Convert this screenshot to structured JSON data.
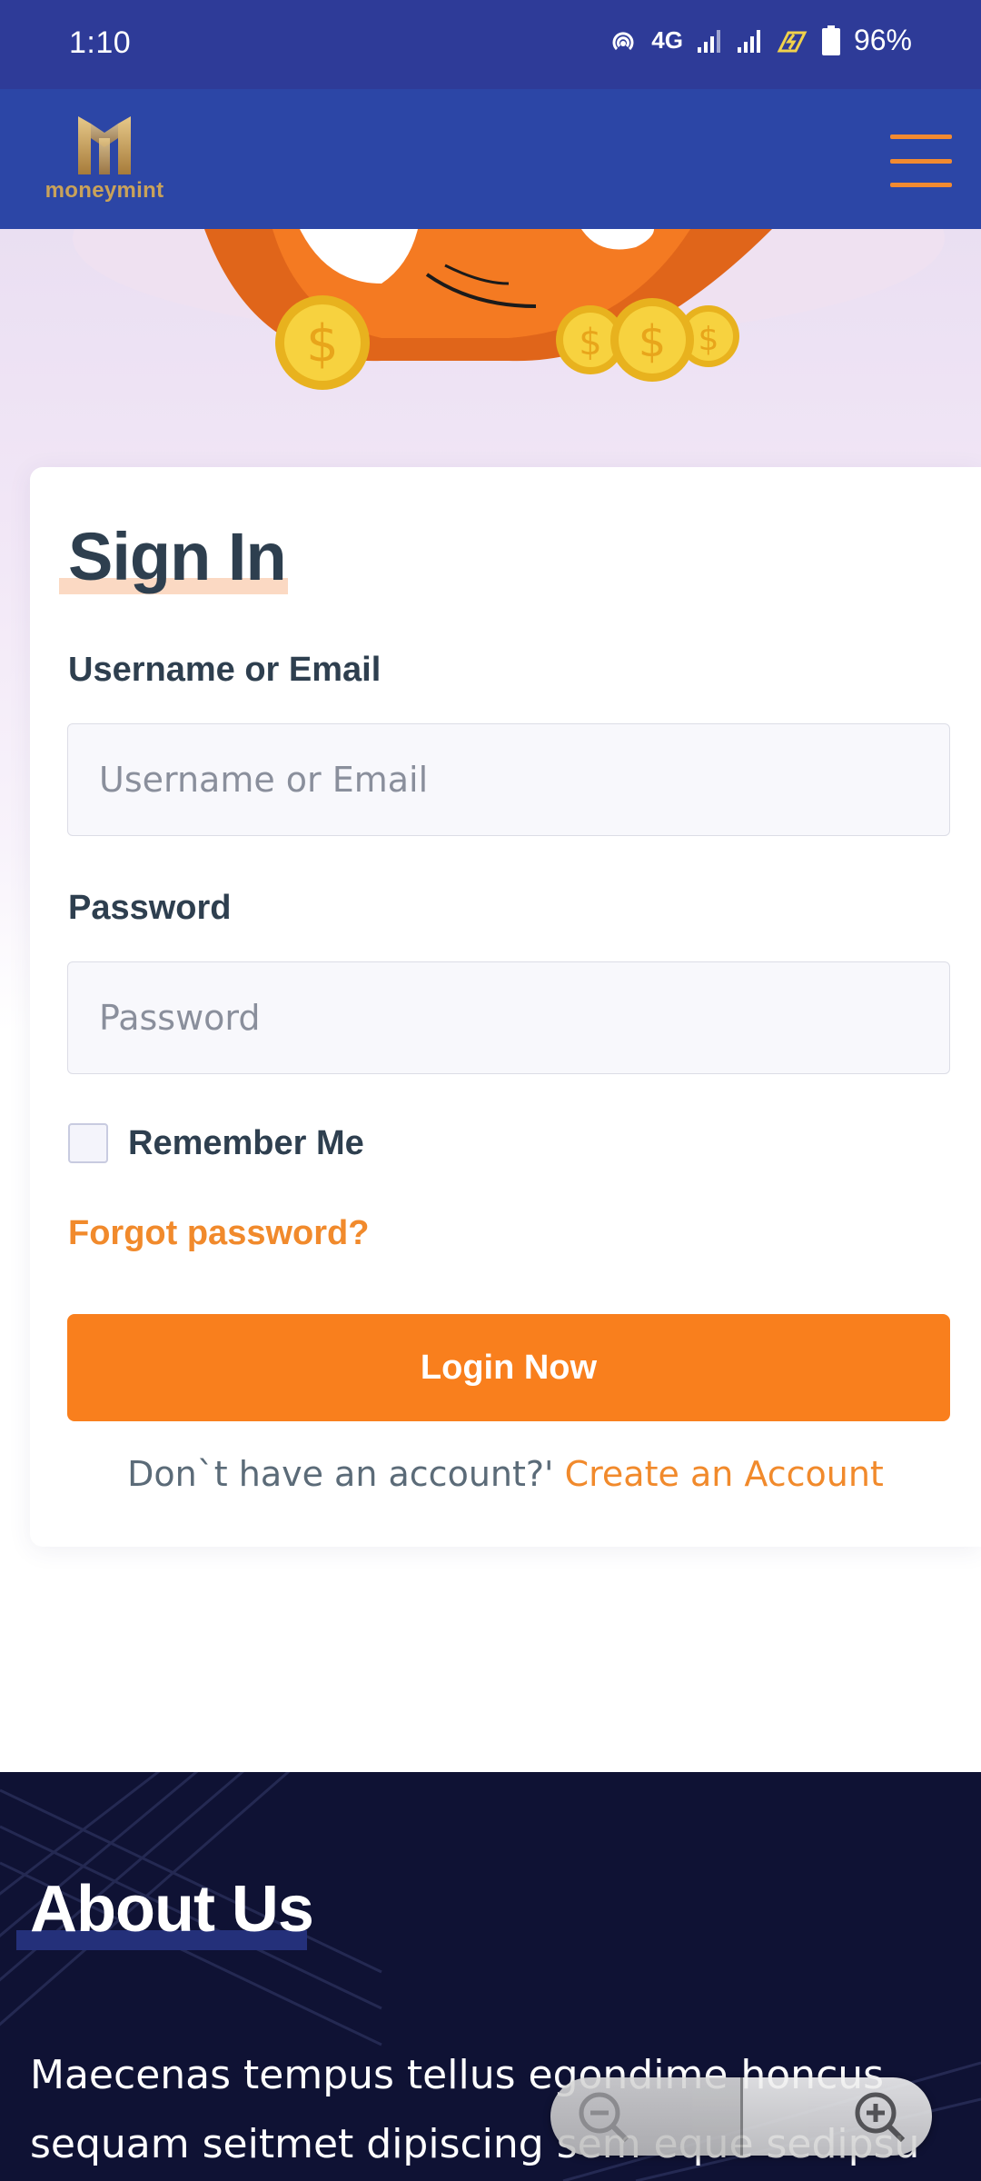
{
  "status_bar": {
    "time": "1:10",
    "network": "4G",
    "battery": "96%",
    "icons": [
      "hotspot-icon",
      "signal-icon",
      "signal-icon",
      "data-saver-icon",
      "battery-icon"
    ]
  },
  "header": {
    "logo_text": "moneymint",
    "menu_icon": "hamburger-menu-icon",
    "colors": {
      "background": "#2c46a6",
      "accent": "#f28a30",
      "gold": "#c9a25a"
    }
  },
  "signin": {
    "title": "Sign In",
    "username": {
      "label": "Username or Email",
      "placeholder": "Username or Email",
      "value": ""
    },
    "password": {
      "label": "Password",
      "placeholder": "Password",
      "value": ""
    },
    "remember_label": "Remember Me",
    "remember_checked": false,
    "forgot_link": "Forgot password?",
    "login_button": "Login Now",
    "no_account_text": "Don`t have an account?'",
    "create_account_link": "Create an Account"
  },
  "about": {
    "title": "About Us",
    "text": "Maecenas tempus tellus egondime honcus sequam seitmet dipiscing sem eque sedipsu"
  },
  "zoom": {
    "out_icon": "zoom-out-icon",
    "in_icon": "zoom-in-icon"
  },
  "theme": {
    "primary": "#f97f1d",
    "text": "#2e3f4f",
    "dark": "#0f1234"
  }
}
